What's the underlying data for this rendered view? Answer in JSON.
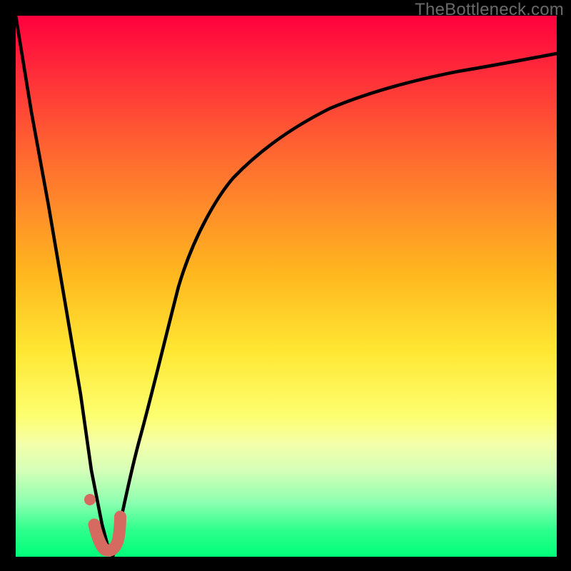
{
  "watermark": "TheBottleneck.com",
  "chart_data": {
    "type": "line",
    "title": "",
    "xlabel": "",
    "ylabel": "",
    "xlim": [
      0,
      100
    ],
    "ylim": [
      0,
      100
    ],
    "note": "Values estimated from pixel positions on a 0–100 normalized grid; y = bottleneck percentage (0 at bottom/green, 100 at top/red). No axis ticks or legend rendered in source.",
    "series": [
      {
        "name": "left-falling-curve",
        "stroke": "#000000",
        "x": [
          0,
          3,
          6,
          9,
          12,
          14,
          16,
          17,
          18
        ],
        "y": [
          100,
          82,
          65,
          48,
          30,
          16,
          6,
          2,
          0
        ]
      },
      {
        "name": "rising-saturation-curve",
        "stroke": "#000000",
        "x": [
          18,
          20,
          23,
          26,
          30,
          35,
          40,
          48,
          58,
          70,
          85,
          100
        ],
        "y": [
          0,
          8,
          22,
          36,
          50,
          62,
          70,
          78,
          84,
          88,
          91,
          93
        ]
      },
      {
        "name": "marker-segment",
        "stroke": "#d46a60",
        "x": [
          14.5,
          15.5,
          16.5,
          18,
          19,
          19.3
        ],
        "y": [
          6,
          3.2,
          1.5,
          1.2,
          3.5,
          7.5
        ],
        "style": "thick-rounded"
      },
      {
        "name": "marker-dot",
        "stroke": "#d46a60",
        "x": [
          13.7
        ],
        "y": [
          10.5
        ],
        "style": "dot"
      }
    ]
  },
  "colors": {
    "frame": "#000000",
    "curve": "#000000",
    "marker": "#d46a60",
    "watermark": "#6a6a6a"
  }
}
